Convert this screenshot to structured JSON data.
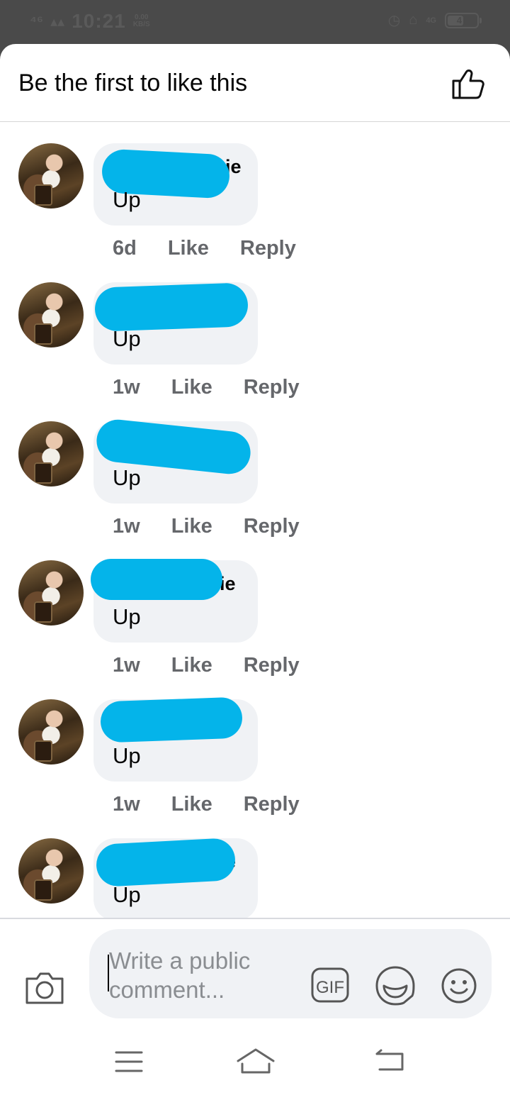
{
  "status_bar": {
    "time": "10:21",
    "net_speed_value": "0.00",
    "net_speed_unit": "KB/S",
    "network_type": "4G",
    "battery_level": "4"
  },
  "header": {
    "title": "Be the first to like this",
    "like_icon": "thumbs-up-outline-icon"
  },
  "comments": [
    {
      "author_suffix": "ie",
      "text": "Up",
      "time": "6d",
      "like_label": "Like",
      "reply_label": "Reply"
    },
    {
      "author_suffix": "",
      "text": "Up",
      "time": "1w",
      "like_label": "Like",
      "reply_label": "Reply"
    },
    {
      "author_suffix": "",
      "text": "Up",
      "time": "1w",
      "like_label": "Like",
      "reply_label": "Reply"
    },
    {
      "author_suffix": "ie",
      "text": "Up",
      "time": "1w",
      "like_label": "Like",
      "reply_label": "Reply"
    },
    {
      "author_suffix": "",
      "text": "Up",
      "time": "1w",
      "like_label": "Like",
      "reply_label": "Reply"
    },
    {
      "author_suffix": "e",
      "text": "Up",
      "time": "",
      "like_label": "",
      "reply_label": ""
    }
  ],
  "composer": {
    "placeholder": "Write a public comment...",
    "gif_label": "GIF",
    "camera_icon": "camera-icon",
    "sticker_icon": "sticker-icon",
    "emoji_icon": "emoji-icon"
  },
  "colors": {
    "redaction": "#04b4ea",
    "bubble": "#f0f2f5",
    "meta_text": "#65676b"
  }
}
